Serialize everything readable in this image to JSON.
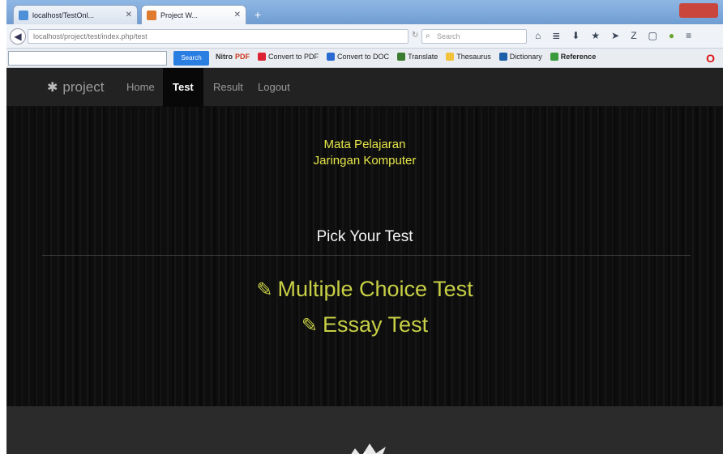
{
  "browser": {
    "tabs": [
      {
        "label": "localhost/TestOnl... ",
        "active": false
      },
      {
        "label": "Project W...",
        "active": true
      }
    ],
    "url": "localhost/project/test/index.php/test",
    "search_placeholder": "Search",
    "toolbar_search_value": "",
    "toolbar_go_label": "Search",
    "bookmarks": [
      {
        "label": "NitroPDF",
        "prefix": "Nitro",
        "suffix": "PDF"
      },
      {
        "label": "Convert to PDF"
      },
      {
        "label": "Convert to DOC"
      },
      {
        "label": "Translate"
      },
      {
        "label": "Thesaurus"
      },
      {
        "label": "Dictionary"
      },
      {
        "label": "Reference"
      }
    ]
  },
  "site": {
    "brand": "project",
    "nav": {
      "home": "Home",
      "test": "Test",
      "result": "Result",
      "logout": "Logout"
    },
    "active_nav": "Test"
  },
  "main": {
    "subject_label": "Mata Pelajaran",
    "subject_name": "Jaringan Komputer",
    "pick_title": "Pick Your Test",
    "tests": {
      "multiple_choice": "Multiple Choice Test",
      "essay": "Essay Test"
    }
  },
  "colors": {
    "accent_yellow": "#e6e64a",
    "link_olive": "#c7cf45",
    "navbar_bg": "#222222"
  },
  "icons": {
    "brand": "gear-icon",
    "test_link": "pencil-icon"
  }
}
